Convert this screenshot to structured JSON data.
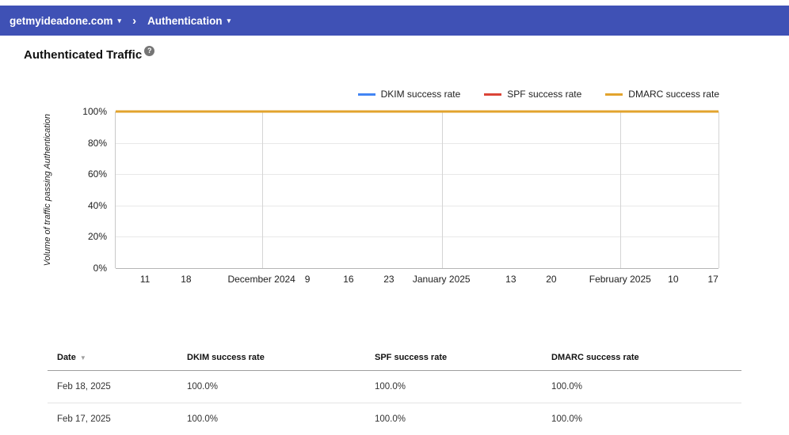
{
  "topbar": {
    "domain_menu": "getmyideadone.com",
    "section_menu": "Authentication",
    "bg_color": "#3f51b5"
  },
  "page": {
    "title": "Authenticated Traffic"
  },
  "icons": {
    "help": "?",
    "breadcrumb_chevron": "›",
    "dropdown_caret": "▾"
  },
  "chart_data": {
    "type": "line",
    "title": "Authenticated Traffic",
    "ylabel": "Volume of traffic passing Authentication",
    "ylim": [
      0,
      100
    ],
    "grid": true,
    "legend_position": "top-right",
    "y_ticks": [
      "100%",
      "80%",
      "60%",
      "40%",
      "20%",
      "0%"
    ],
    "x_ticks": [
      {
        "label": "11",
        "pos": 5.0
      },
      {
        "label": "18",
        "pos": 11.8
      },
      {
        "label": "December 2024",
        "pos": 24.3
      },
      {
        "label": "9",
        "pos": 31.9
      },
      {
        "label": "16",
        "pos": 38.7
      },
      {
        "label": "23",
        "pos": 45.4
      },
      {
        "label": "January 2025",
        "pos": 54.1
      },
      {
        "label": "13",
        "pos": 65.6
      },
      {
        "label": "20",
        "pos": 72.3
      },
      {
        "label": "February 2025",
        "pos": 83.7
      },
      {
        "label": "10",
        "pos": 92.5
      },
      {
        "label": "17",
        "pos": 99.1
      }
    ],
    "month_gridlines": [
      24.3,
      54.1,
      83.7,
      100
    ],
    "series": [
      {
        "name": "DKIM success rate",
        "color": "#4285f4",
        "values": [
          100,
          100,
          100,
          100,
          100,
          100,
          100,
          100,
          100,
          100,
          100,
          100
        ]
      },
      {
        "name": "SPF success rate",
        "color": "#db4437",
        "values": [
          100,
          100,
          100,
          100,
          100,
          100,
          100,
          100,
          100,
          100,
          100,
          100
        ]
      },
      {
        "name": "DMARC success rate",
        "color": "#e2a32d",
        "values": [
          100,
          100,
          100,
          100,
          100,
          100,
          100,
          100,
          100,
          100,
          100,
          100
        ]
      }
    ]
  },
  "table": {
    "headers": [
      "Date",
      "DKIM success rate",
      "SPF success rate",
      "DMARC success rate"
    ],
    "sort_column": "Date",
    "sort_icon": "▼",
    "rows": [
      [
        "Feb 18, 2025",
        "100.0%",
        "100.0%",
        "100.0%"
      ],
      [
        "Feb 17, 2025",
        "100.0%",
        "100.0%",
        "100.0%"
      ]
    ]
  }
}
